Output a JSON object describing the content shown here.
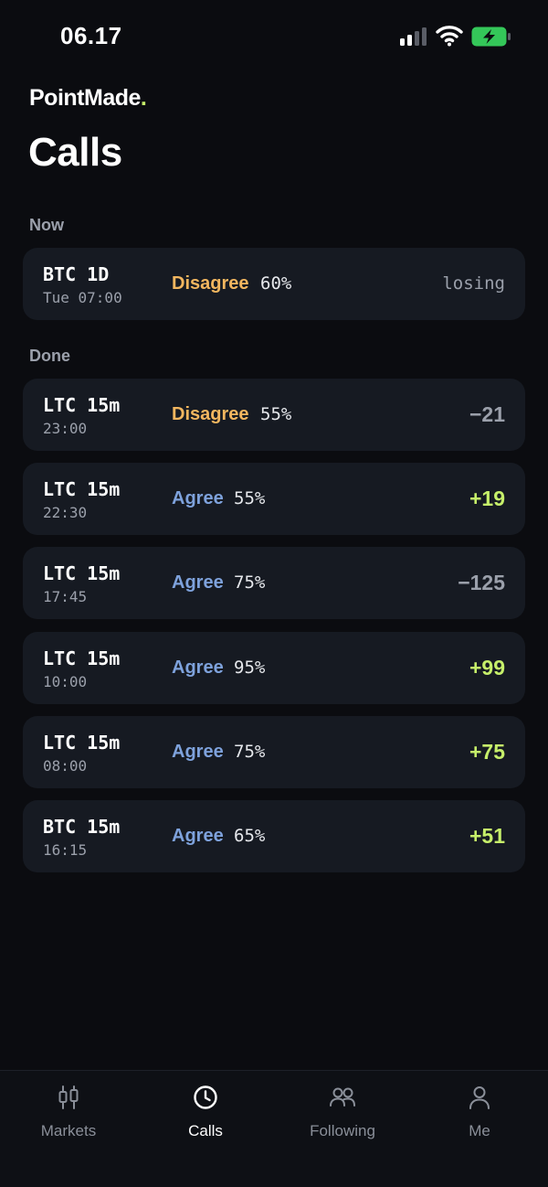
{
  "status_bar": {
    "time": "06.17"
  },
  "brand": {
    "name": "PointMade",
    "dot": ".",
    "accent_color": "#c6ef6a"
  },
  "page_title": "Calls",
  "sections": {
    "now_label": "Now",
    "done_label": "Done"
  },
  "now_calls": [
    {
      "symbol": "BTC 1D",
      "time": "Tue 07:00",
      "call": "Disagree",
      "percent": "60%",
      "result": "losing"
    }
  ],
  "done_calls": [
    {
      "symbol": "LTC 15m",
      "time": "23:00",
      "call": "Disagree",
      "percent": "55%",
      "result": "−21"
    },
    {
      "symbol": "LTC 15m",
      "time": "22:30",
      "call": "Agree",
      "percent": "55%",
      "result": "+19"
    },
    {
      "symbol": "LTC 15m",
      "time": "17:45",
      "call": "Agree",
      "percent": "75%",
      "result": "−125"
    },
    {
      "symbol": "LTC 15m",
      "time": "10:00",
      "call": "Agree",
      "percent": "95%",
      "result": "+99"
    },
    {
      "symbol": "LTC 15m",
      "time": "08:00",
      "call": "Agree",
      "percent": "75%",
      "result": "+75"
    },
    {
      "symbol": "BTC 15m",
      "time": "16:15",
      "call": "Agree",
      "percent": "65%",
      "result": "+51"
    }
  ],
  "colors": {
    "background": "#0b0c10",
    "card": "#161a22",
    "disagree": "#f2b65f",
    "agree": "#7ea2dc",
    "positive": "#c6ef6a",
    "muted": "#9ba0ab"
  },
  "tabs": [
    {
      "label": "Markets",
      "icon": "candlestick-icon",
      "active": false
    },
    {
      "label": "Calls",
      "icon": "clock-icon",
      "active": true
    },
    {
      "label": "Following",
      "icon": "people-icon",
      "active": false
    },
    {
      "label": "Me",
      "icon": "person-icon",
      "active": false
    }
  ]
}
